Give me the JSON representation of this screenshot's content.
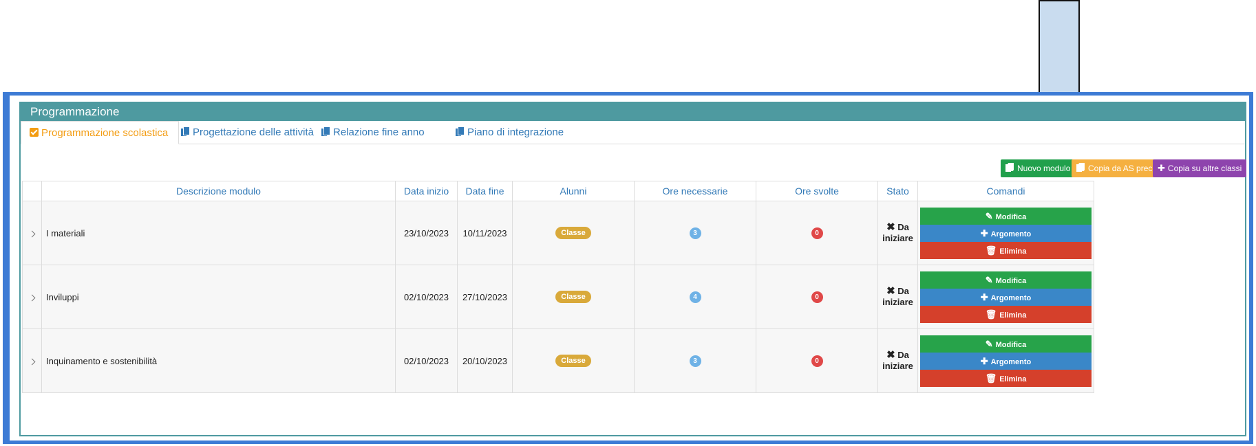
{
  "panel": {
    "title": "Programmazione"
  },
  "tabs": [
    {
      "label": "Programmazione scolastica",
      "icon": "clipboard-check-icon",
      "active": true
    },
    {
      "label": "Progettazione delle attività",
      "icon": "copy-icon"
    },
    {
      "label": "Relazione fine anno",
      "icon": "copy-icon"
    },
    {
      "label": "Piano di integrazione",
      "icon": "copy-icon"
    }
  ],
  "toolbar": {
    "new_module": "Nuovo modulo",
    "copy_prev": "Copia da AS prec",
    "copy_classes": "Copia su altre classi"
  },
  "table": {
    "headers": [
      "Descrizione modulo",
      "Data inizio",
      "Data fine",
      "Alunni",
      "Ore necessarie",
      "Ore svolte",
      "Stato",
      "Comandi"
    ],
    "rows": [
      {
        "description": "I materiali",
        "start": "23/10/2023",
        "end": "10/11/2023",
        "students": "Classe",
        "hours_needed": "3",
        "hours_done": "0",
        "status_line1": "Da",
        "status_line2": "iniziare"
      },
      {
        "description": "Inviluppi",
        "start": "02/10/2023",
        "end": "27/10/2023",
        "students": "Classe",
        "hours_needed": "4",
        "hours_done": "0",
        "status_line1": "Da",
        "status_line2": "iniziare"
      },
      {
        "description": "Inquinamento e sostenibilità",
        "start": "02/10/2023",
        "end": "20/10/2023",
        "students": "Classe",
        "hours_needed": "3",
        "hours_done": "0",
        "status_line1": "Da",
        "status_line2": "iniziare"
      }
    ],
    "commands": {
      "edit": "Modifica",
      "topic": "Argomento",
      "delete": "Elimina"
    }
  },
  "colors": {
    "panel_teal": "#4e9aa0",
    "frame_blue": "#3d7bd5",
    "active_tab_orange": "#f39c12",
    "btn_green": "#21a04c",
    "btn_orange": "#f5b040",
    "btn_purple": "#8e44ad",
    "status_red": "#e02020"
  }
}
